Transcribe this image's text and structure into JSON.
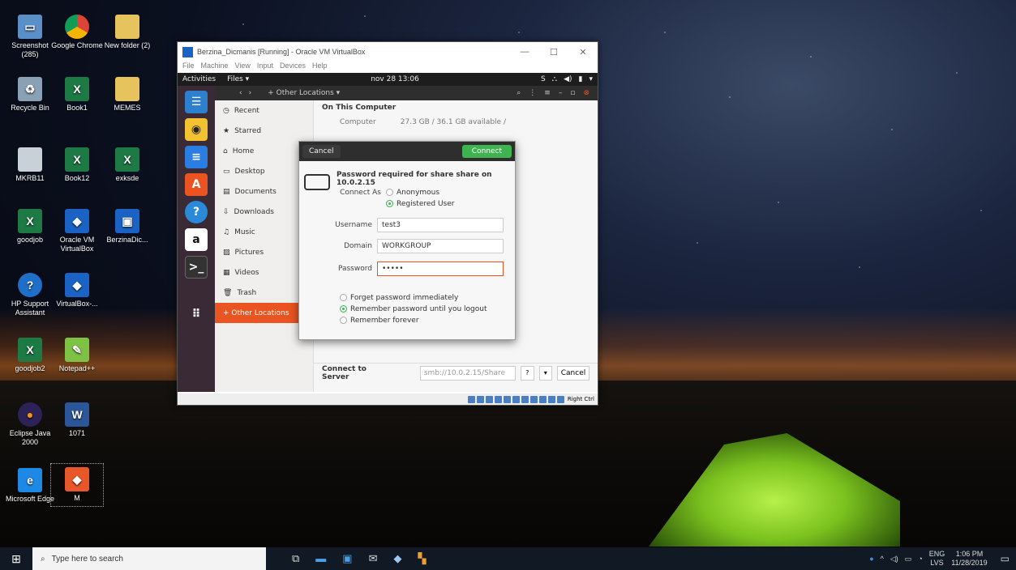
{
  "desktop": {
    "icons": [
      {
        "label": "Screenshot (285)"
      },
      {
        "label": "Google Chrome"
      },
      {
        "label": "New folder (2)"
      },
      {
        "label": "Recycle Bin"
      },
      {
        "label": "Book1"
      },
      {
        "label": "MEMES"
      },
      {
        "label": "MKRB11"
      },
      {
        "label": "Book12"
      },
      {
        "label": "exksde"
      },
      {
        "label": "goodjob"
      },
      {
        "label": "Oracle VM VirtualBox"
      },
      {
        "label": "BerzinaDic..."
      },
      {
        "label": "HP Support Assistant"
      },
      {
        "label": "VirtualBox-..."
      },
      {
        "label": "goodjob2"
      },
      {
        "label": "Notepad++"
      },
      {
        "label": "Eclipse Java 2000"
      },
      {
        "label": "1071"
      },
      {
        "label": "Microsoft Edge"
      },
      {
        "label": "M"
      }
    ]
  },
  "vbox": {
    "title": "Berzina_Dicmanis [Running] - Oracle VM VirtualBox",
    "menu": [
      "File",
      "Machine",
      "View",
      "Input",
      "Devices",
      "Help"
    ],
    "status_host_key": "Right Ctrl"
  },
  "guest": {
    "activities": "Activities",
    "app_menu": "Files ▾",
    "clock": "nov 28 13:06",
    "location": "+ Other Locations ▾",
    "sidebar": [
      "Recent",
      "Starred",
      "Home",
      "Desktop",
      "Documents",
      "Downloads",
      "Music",
      "Pictures",
      "Videos",
      "Trash",
      "+ Other Locations"
    ],
    "section_title": "On This Computer",
    "computer_label": "Computer",
    "computer_space": "27.3 GB / 36.1 GB available   /",
    "connect_label": "Connect to Server",
    "server_placeholder": "smb://10.0.2.15/Share",
    "cancel": "Cancel"
  },
  "dialog": {
    "cancel": "Cancel",
    "connect": "Connect",
    "title": "Password required for share share on 10.0.2.15",
    "connect_as_label": "Connect As",
    "anonymous": "Anonymous",
    "registered": "Registered User",
    "username_label": "Username",
    "username_value": "test3",
    "domain_label": "Domain",
    "domain_value": "WORKGROUP",
    "password_label": "Password",
    "password_value": "•••••",
    "forget": "Forget password immediately",
    "remember_logout": "Remember password until you logout",
    "remember_forever": "Remember forever"
  },
  "taskbar": {
    "search_placeholder": "Type here to search",
    "lang": "ENG",
    "lang2": "LVS",
    "time": "1:06 PM",
    "date": "11/28/2019"
  }
}
